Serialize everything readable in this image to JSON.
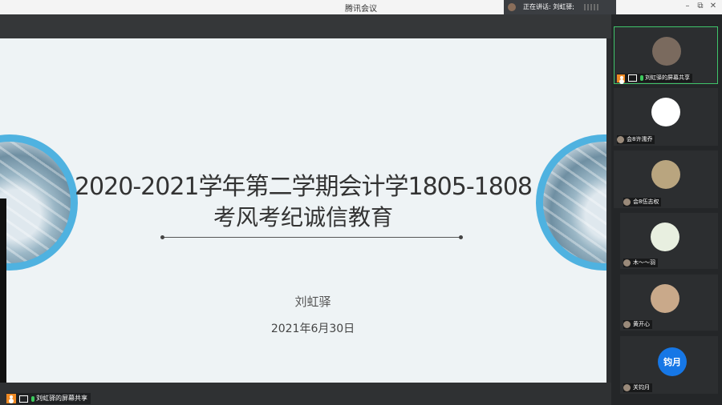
{
  "window": {
    "title": "腾讯会议"
  },
  "speaking": {
    "text": "正在讲话: 刘虹驿;"
  },
  "window_controls": {
    "minimize": "–",
    "restore": "⧉",
    "close": "✕"
  },
  "slide": {
    "title_line1": "2020-2021学年第二学期会计学1805-1808",
    "title_line2": "考风考纪诚信教育",
    "presenter": "刘虹驿",
    "date": "2021年6月30日"
  },
  "screen_share": {
    "label": "刘虹驿的屏幕共享"
  },
  "participants": [
    {
      "name": "刘虹驿的屏幕共享",
      "avatar_color": "#7a6a5e",
      "active": true
    },
    {
      "name": "会8许濡乔",
      "avatar_color": "#ffffff"
    },
    {
      "name": "会8伍志权",
      "avatar_color": "#b9a57f"
    },
    {
      "name": "木～～羽",
      "avatar_color": "#e8efe0"
    },
    {
      "name": "黄开心",
      "avatar_color": "#c9a98a"
    },
    {
      "name": "关钧月",
      "avatar_color": "#1677e6",
      "initial": "钧月"
    }
  ],
  "colors": {
    "accent_ring": "#4fb2e0",
    "active_border": "#3fc56a",
    "share_icon": "#f08a24",
    "mic": "#3cc95c"
  }
}
